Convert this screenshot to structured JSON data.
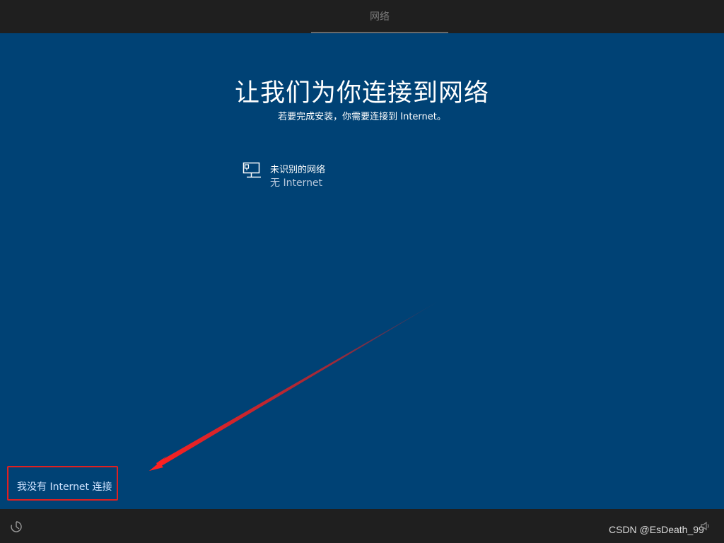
{
  "header": {
    "tab_label": "网络"
  },
  "main": {
    "title": "让我们为你连接到网络",
    "subtitle": "若要完成安装，你需要连接到 Internet。",
    "network": {
      "icon": "ethernet-icon",
      "name": "未识别的网络",
      "status": "无 Internet"
    },
    "no_internet_link": "我没有 Internet 连接"
  },
  "footer": {
    "ease_of_access_icon": "ease-of-access-icon",
    "volume_icon": "volume-icon",
    "watermark": "CSDN @EsDeath_99"
  },
  "colors": {
    "background": "#004275",
    "bar": "#1f1f1f",
    "annotation": "#e02020"
  }
}
